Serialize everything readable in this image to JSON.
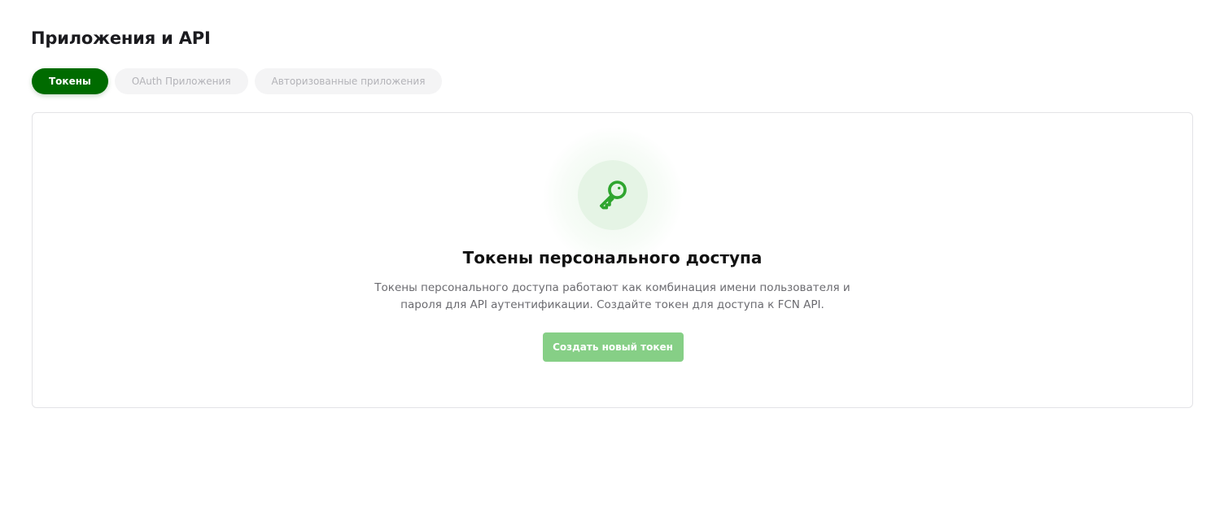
{
  "page": {
    "title": "Приложения и API"
  },
  "tabs": [
    {
      "label": "Токены",
      "active": true
    },
    {
      "label": "OAuth Приложения",
      "active": false
    },
    {
      "label": "Авторизованные приложения",
      "active": false
    }
  ],
  "empty_state": {
    "icon": "key-icon",
    "title": "Токены персонального доступа",
    "description": "Токены персонального доступа работают как комбинация имени пользователя и пароля для API аутентификации. Создайте токен для доступа к FCN API.",
    "button_label": "Создать новый токен"
  },
  "colors": {
    "accent": "#006b00",
    "icon_green": "#2fa52f",
    "button": "#86cf86"
  }
}
